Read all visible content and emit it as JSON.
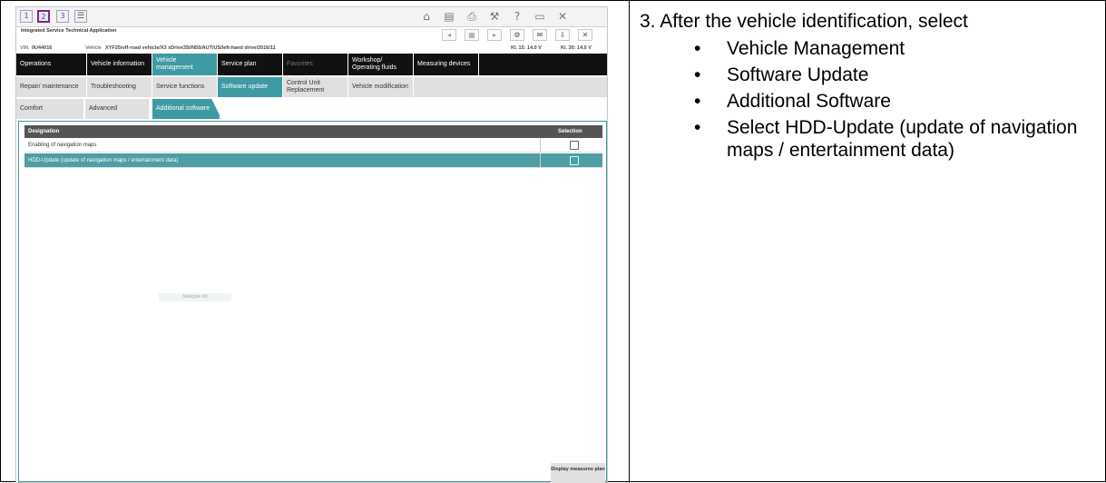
{
  "instructions": {
    "title": "3. After the vehicle identification, select",
    "bullets": [
      "Vehicle Management",
      "Software Update",
      "Additional Software",
      "Select HDD-Update (update of navigation maps / entertainment data)"
    ],
    "bullet_glyph": "•"
  },
  "app": {
    "title": "Integrated Service Technical Application",
    "workspace_tabs": [
      "1",
      "2",
      "3"
    ],
    "vin_label": "VIN",
    "vin": "0U44016",
    "vehicle_label": "Vehicle",
    "vehicle": "XYF25/off-road vehicle/X3 xDrive35i/N55/AUT/US/left-hand drive/2016/11",
    "kl15": "Kl. 15:  14.0 V",
    "kl30": "Kl. 30:  14.0 V",
    "main_tabs": [
      "Operations",
      "Vehicle information",
      "Vehicle management",
      "Service plan",
      "Favorites",
      "Workshop/ Operating fluids",
      "Measuring devices"
    ],
    "sub_tabs": [
      "Repair/ maintenance",
      "Troubleshooting",
      "Service functions",
      "Software update",
      "Control Unit Replacement",
      "Vehicle modification"
    ],
    "third_tabs": [
      "Comfort",
      "Advanced",
      "Additional software"
    ],
    "table": {
      "col_designation": "Designation",
      "col_selection": "Selection",
      "rows": [
        "Enabling of navigation maps",
        "HDD-Update (update of navigation maps / entertainment data)"
      ]
    },
    "nav_hint": "Navigate list",
    "display_measures": "Display measures plan",
    "icons": [
      "home-icon",
      "book-icon",
      "printer-icon",
      "wrench-icon",
      "help-icon",
      "minimize-icon",
      "close-icon",
      "back-icon",
      "forward-icon",
      "gear-icon",
      "mail-icon",
      "download-icon"
    ],
    "accent_color": "#3e9aa3"
  }
}
